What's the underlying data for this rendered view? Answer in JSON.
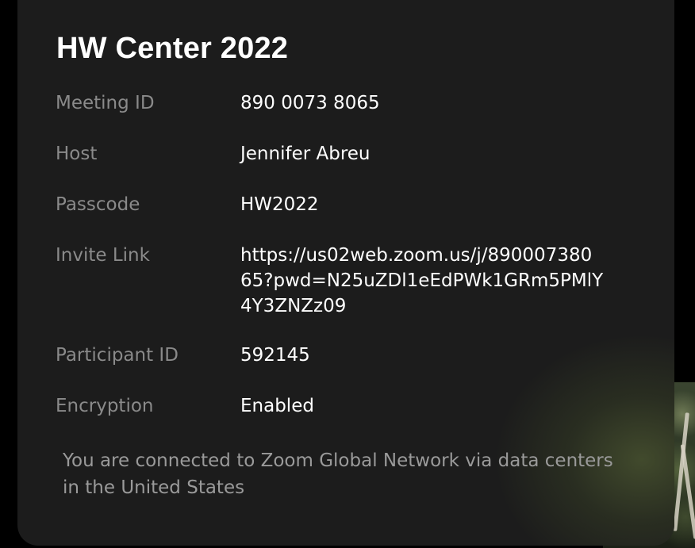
{
  "meeting_info": {
    "title": "HW Center 2022",
    "rows": [
      {
        "label": "Meeting ID",
        "value": "890 0073 8065"
      },
      {
        "label": "Host",
        "value": "Jennifer Abreu"
      },
      {
        "label": "Passcode",
        "value": "HW2022"
      },
      {
        "label": "Invite Link",
        "value": "https://us02web.zoom.us/j/890007380\n65?pwd=N25uZDl1eEdPWk1GRm5PMlY\n4Y3ZNZz09"
      },
      {
        "label": "Participant ID",
        "value": "592145"
      },
      {
        "label": "Encryption",
        "value": "Enabled"
      }
    ],
    "footer": "You are connected to Zoom Global Network via data centers in the United States"
  },
  "colors": {
    "panel": "#1c1c1c",
    "label": "#8a8a8a",
    "value": "#ffffff"
  }
}
